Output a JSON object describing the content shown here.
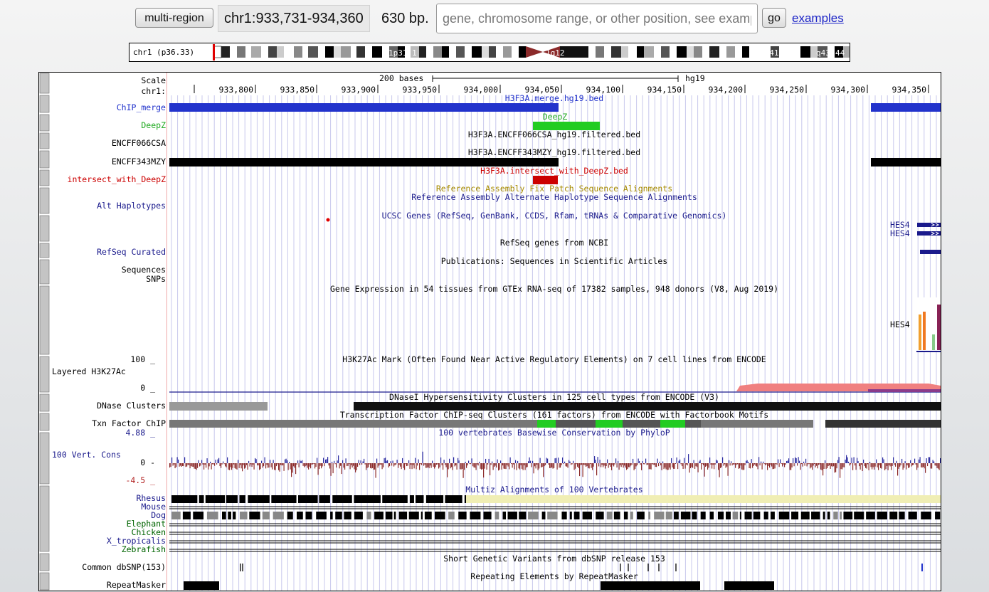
{
  "header": {
    "multi_region_label": "multi-region",
    "position": "chr1:933,731-934,360",
    "size": "630 bp.",
    "search_placeholder": "gene, chromosome range, or other position, see examples",
    "go_label": "go",
    "examples_label": "examples"
  },
  "ideogram": {
    "label": "chr1 (p36.33)",
    "bands": [
      "1p31.1",
      "1q12",
      "1q41",
      "q43",
      "44"
    ]
  },
  "ruler": {
    "scale_label": "Scale",
    "chrom_label": "chr1:",
    "scale_text": "200 bases",
    "assembly": "hg19",
    "ticks": [
      "933,800",
      "933,850",
      "933,900",
      "933,950",
      "934,000",
      "934,050",
      "934,100",
      "934,150",
      "934,200",
      "934,250",
      "934,300",
      "934,350"
    ]
  },
  "tracks": {
    "chip_merge": {
      "label": "ChIP_merge",
      "title": "H3F3A.merge.hg19.bed"
    },
    "deepz": {
      "label": "DeepZ",
      "title": "DeepZ"
    },
    "encff066csa": {
      "label": "ENCFF066CSA",
      "title": "H3F3A.ENCFF066CSA_hg19.filtered.bed"
    },
    "encff343mzy": {
      "label": "ENCFF343MZY",
      "title": "H3F3A.ENCFF343MZY_hg19.filtered.bed"
    },
    "intersect": {
      "label": "intersect_with_DeepZ",
      "title": "H3F3A.intersect_with_DeepZ.bed"
    },
    "fix_patch": {
      "title": "Reference Assembly Fix Patch Sequence Alignments"
    },
    "alt_haplotypes": {
      "label": "Alt Haplotypes",
      "title": "Reference Assembly Alternate Haplotype Sequence Alignments"
    },
    "ucsc_genes": {
      "title": "UCSC Genes (RefSeq, GenBank, CCDS, Rfam, tRNAs & Comparative Genomics)",
      "gene1": "HES4",
      "gene2": "HES4"
    },
    "refseq": {
      "label": "RefSeq Curated",
      "title": "RefSeq genes from NCBI"
    },
    "publications": {
      "label": "Sequences",
      "title": "Publications: Sequences in Scientific Articles"
    },
    "snps_label": "SNPs",
    "gtex": {
      "title": "Gene Expression in 54 tissues from GTEx RNA-seq of 17382 samples, 948 donors (V8, Aug 2019)",
      "gene": "HES4"
    },
    "h3k27ac": {
      "label": "Layered H3K27Ac",
      "title": "H3K27Ac Mark (Often Found Near Active Regulatory Elements) on 7 cell lines from ENCODE",
      "max": "100 _",
      "min": "0 _"
    },
    "dnase": {
      "label": "DNase Clusters",
      "title": "DNaseI Hypersensitivity Clusters in 125 cell types from ENCODE (V3)"
    },
    "txn": {
      "label": "Txn Factor ChIP",
      "title": "Transcription Factor ChIP-seq Clusters (161 factors) from ENCODE with Factorbook Motifs"
    },
    "cons": {
      "label": "100 Vert. Cons",
      "title": "100 vertebrates Basewise Conservation by PhyloP",
      "max": "4.88 _",
      "zero": "0 -",
      "min": "-4.5 _"
    },
    "multiz": {
      "title": "Multiz Alignments of 100 Vertebrates",
      "species": [
        "Rhesus",
        "Mouse",
        "Dog",
        "Elephant",
        "Chicken",
        "X_tropicalis",
        "Zebrafish"
      ]
    },
    "dbsnp": {
      "label": "Common dbSNP(153)",
      "title": "Short Genetic Variants from dbSNP release 153"
    },
    "repeatmasker": {
      "label": "RepeatMasker",
      "title": "Repeating Elements by RepeatMasker"
    }
  },
  "colors": {
    "chip_blue": "#2233cc",
    "deepz_green": "#22cc22",
    "intersect_red": "#cc0000",
    "label_navy": "#1a1a8c",
    "fix_patch_gold": "#a68a00",
    "h3k27ac_pink": "#f08080",
    "cons_red": "#8b2a2a",
    "cons_blue": "#2a2aa0",
    "multiz_yellow": "#f0eeb4"
  }
}
